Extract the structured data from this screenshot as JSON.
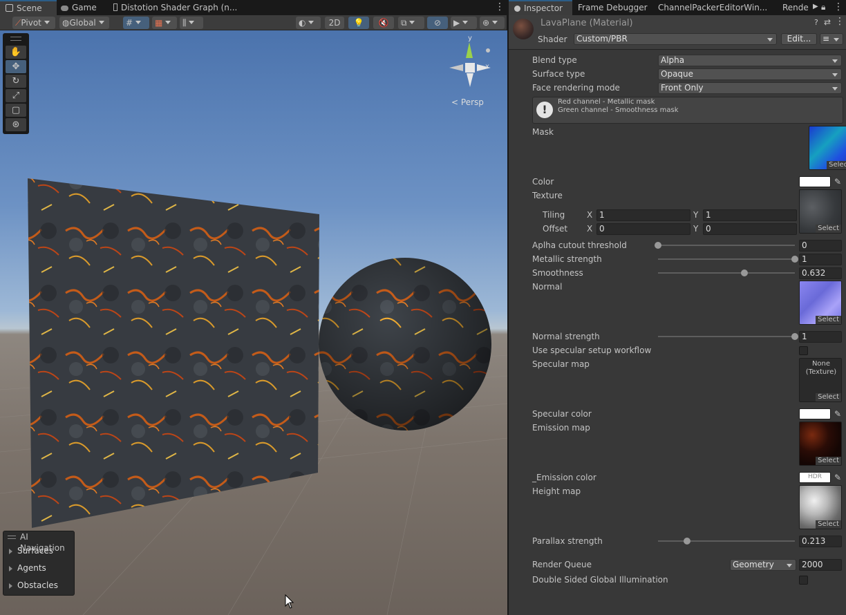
{
  "scene_tabs": [
    {
      "label": "Scene"
    },
    {
      "label": "Game"
    },
    {
      "label": "Distotion Shader Graph (n..."
    }
  ],
  "toolbar": {
    "pivot": "Pivot",
    "global": "Global",
    "mode_2d": "2D"
  },
  "gizmo": {
    "y": "y",
    "x": "x",
    "persp": "Persp"
  },
  "nav_panel": {
    "title": "AI Navigation",
    "items": [
      "Surfaces",
      "Agents",
      "Obstacles"
    ]
  },
  "inspector_tabs": [
    {
      "label": "Inspector"
    },
    {
      "label": "Frame Debugger"
    },
    {
      "label": "ChannelPackerEditorWin..."
    },
    {
      "label": "Rende"
    }
  ],
  "material": {
    "name": "LavaPlane (Material)",
    "shader_label": "Shader",
    "shader": "Custom/PBR",
    "edit": "Edit..."
  },
  "props": {
    "blend_type": {
      "label": "Blend type",
      "value": "Alpha"
    },
    "surface_type": {
      "label": "Surface type",
      "value": "Opaque"
    },
    "face_mode": {
      "label": "Face rendering mode",
      "value": "Front Only"
    },
    "info": {
      "line1": "Red channel - Metallic mask",
      "line2": "Green channel - Smoothness mask"
    },
    "mask": {
      "label": "Mask"
    },
    "color": {
      "label": "Color"
    },
    "texture": {
      "label": "Texture"
    },
    "tiling": {
      "label": "Tiling",
      "x_label": "X",
      "x": "1",
      "y_label": "Y",
      "y": "1"
    },
    "offset": {
      "label": "Offset",
      "x_label": "X",
      "x": "0",
      "y_label": "Y",
      "y": "0"
    },
    "cutout": {
      "label": "Aplha cutout threshold",
      "value": "0",
      "fraction": 0
    },
    "metallic": {
      "label": "Metallic strength",
      "value": "1",
      "fraction": 1
    },
    "smoothness": {
      "label": "Smoothness",
      "value": "0.632",
      "fraction": 0.632
    },
    "normal": {
      "label": "Normal"
    },
    "normal_strength": {
      "label": "Normal strength",
      "value": "1",
      "fraction": 1
    },
    "specular_workflow": {
      "label": "Use specular setup workflow"
    },
    "specular_map": {
      "label": "Specular map",
      "none_text_1": "None",
      "none_text_2": "(Texture)"
    },
    "specular_color": {
      "label": "Specular color"
    },
    "emission_map": {
      "label": "Emission map"
    },
    "emission_color": {
      "label": "_Emission color",
      "hdr": "HDR"
    },
    "height_map": {
      "label": "Height map"
    },
    "parallax": {
      "label": "Parallax strength",
      "value": "0.213",
      "fraction": 0.213
    },
    "render_queue": {
      "label": "Render Queue",
      "mode": "Geometry",
      "value": "2000"
    },
    "double_sided_gi": {
      "label": "Double Sided Global Illumination"
    }
  },
  "select_label": "Select",
  "colors": {
    "accent": "#2c5d87",
    "panel": "#383838",
    "scene_bg": "#282828"
  }
}
